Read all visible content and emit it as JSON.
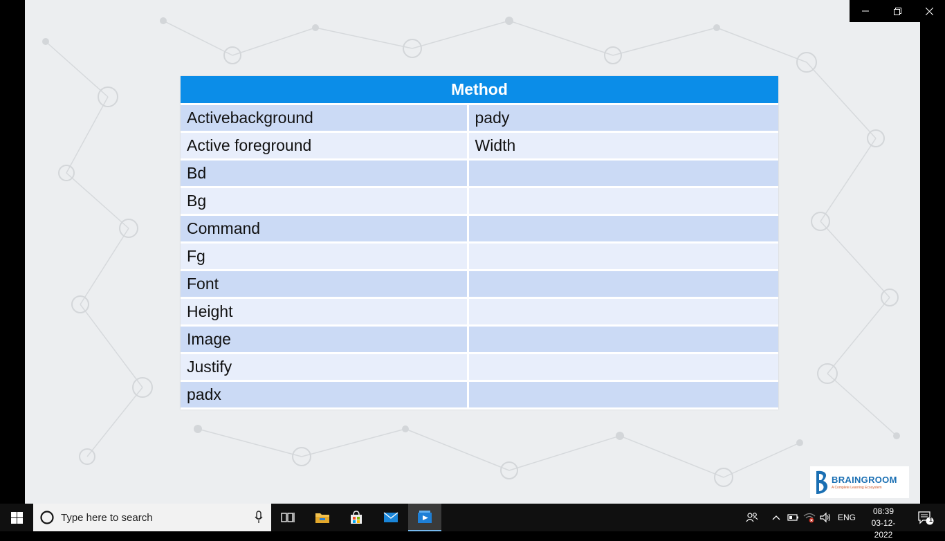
{
  "window": {
    "minimize_icon": "minimize-icon",
    "restore_icon": "restore-icon",
    "close_icon": "close-icon"
  },
  "table": {
    "header": "Method",
    "rows": [
      [
        "Activebackground",
        "pady"
      ],
      [
        "Active foreground",
        "Width"
      ],
      [
        "Bd",
        ""
      ],
      [
        "Bg",
        ""
      ],
      [
        "Command",
        ""
      ],
      [
        "Fg",
        ""
      ],
      [
        "Font",
        ""
      ],
      [
        "Height",
        ""
      ],
      [
        "Image",
        ""
      ],
      [
        "Justify",
        ""
      ],
      [
        "padx",
        ""
      ]
    ]
  },
  "logo": {
    "name": "BRAINGROOM",
    "tagline": "A Complete Learning Ecosystem"
  },
  "taskbar": {
    "search_placeholder": "Type here to search",
    "language": "ENG",
    "time": "08:39",
    "date": "03-12-2022",
    "notification_count": "1"
  },
  "colors": {
    "header_blue": "#0b8de8",
    "row_odd": "#cbdaf5",
    "row_even": "#e8eefb",
    "taskbar": "#101010"
  }
}
